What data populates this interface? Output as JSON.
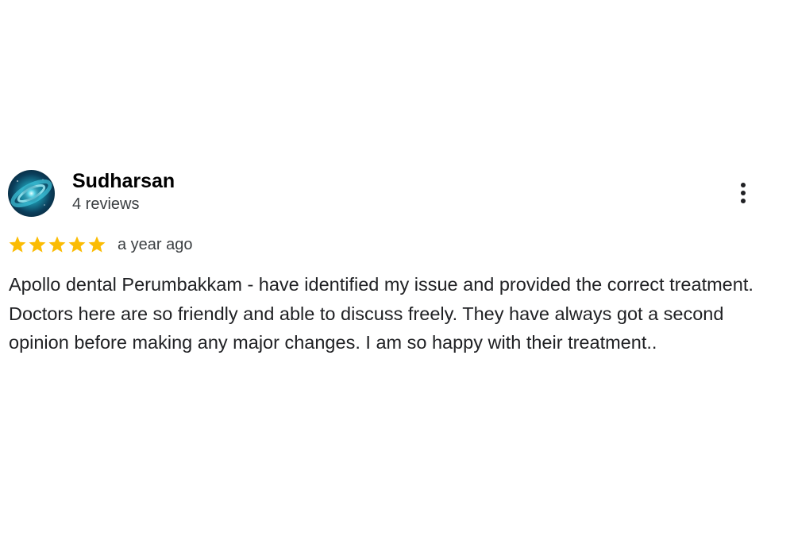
{
  "review": {
    "reviewer_name": "Sudharsan",
    "review_count": "4 reviews",
    "rating": 5,
    "rating_max": 5,
    "date": "a year ago",
    "text": "Apollo dental Perumbakkam - have identified my issue and provided the correct treatment. Doctors here are so friendly and able to discuss freely. They have always got a second opinion before making any major changes. I am so happy with their treatment..",
    "star_color": "#fbbc04",
    "avatar_icon": "galaxy-avatar",
    "menu_icon": "more-vert-icon"
  }
}
